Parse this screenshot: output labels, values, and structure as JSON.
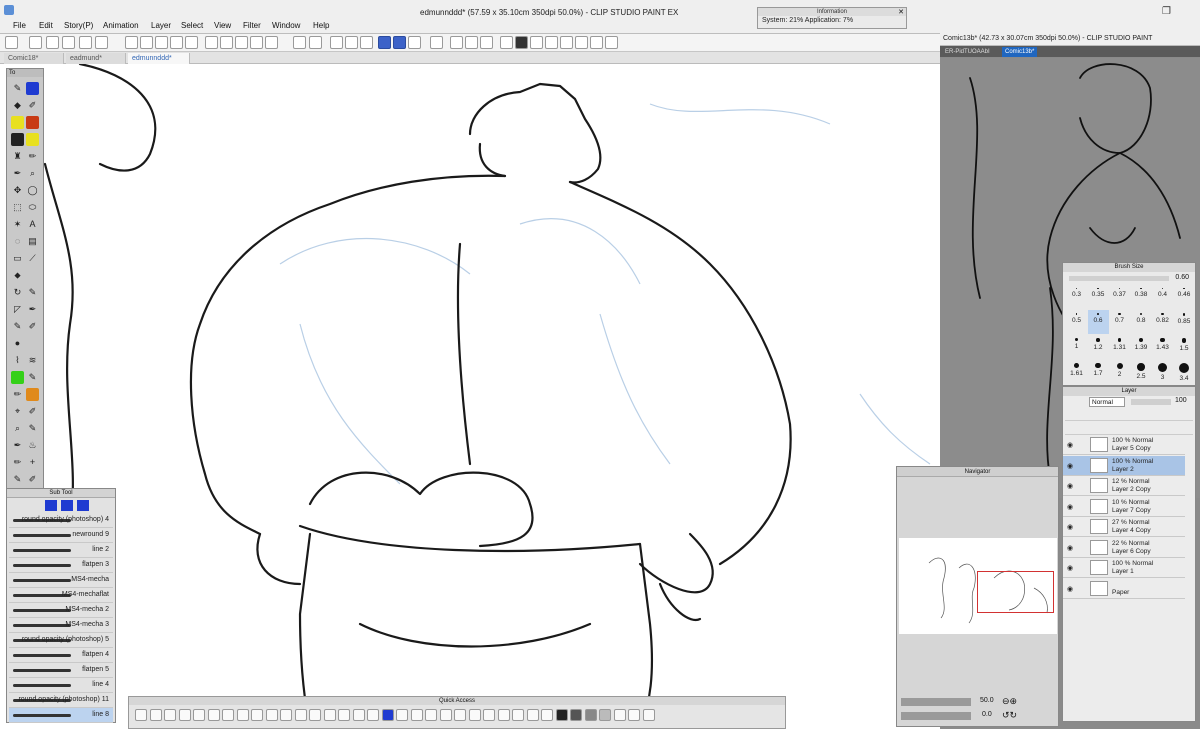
{
  "app": {
    "main_title": "edmunnddd* (57.59 x 35.10cm 350dpi 50.0%) - CLIP STUDIO PAINT EX",
    "menu": [
      "File",
      "Edit",
      "Story(P)",
      "Animation",
      "Layer",
      "Select",
      "View",
      "Filter",
      "Window",
      "Help"
    ]
  },
  "doc_tabs": [
    "Comic18*",
    "eadmund*",
    "edmunnddd*"
  ],
  "info_window": {
    "title": "Information",
    "system": "System: 21%  Application: 7%"
  },
  "right_doc": {
    "title": "Comic13b* (42.73 x 30.07cm 350dpi 50.0%) - CLIP STUDIO PAINT",
    "tabs": [
      "ER-PidTUOAAbI",
      "Comic13b*"
    ]
  },
  "tool_palette": {
    "title": "To"
  },
  "sub_tool": {
    "title": "Sub Tool",
    "items": [
      "round opacity (photoshop) 4",
      "newround 9",
      "line 2",
      "flatpen 3",
      "MS4-mecha",
      "MS4-mechaflat",
      "MS4-mecha 2",
      "MS4-mecha 3",
      "round opacity (photoshop) 5",
      "flatpen 4",
      "flatpen 5",
      "line 4",
      "round opacity (photoshop) 11",
      "line 8"
    ]
  },
  "quick_access": {
    "title": "Quick Access"
  },
  "navigator": {
    "title": "Navigator",
    "zoom": "50.0",
    "angle": "0.0"
  },
  "brush_size": {
    "title": "Brush Size",
    "current": "0.60",
    "sizes": [
      "0.3",
      "0.35",
      "0.37",
      "0.38",
      "0.4",
      "0.46",
      "0.5",
      "0.6",
      "0.7",
      "0.8",
      "0.82",
      "0.85",
      "1",
      "1.2",
      "1.31",
      "1.39",
      "1.43",
      "1.5",
      "1.61",
      "1.7",
      "2",
      "2.5",
      "3",
      "3.4"
    ]
  },
  "layer_panel": {
    "title": "Layer",
    "blend_mode": "Normal",
    "opacity": "100",
    "layers": [
      {
        "line1": "100 % Normal",
        "line2": "Layer 5 Copy"
      },
      {
        "line1": "100 % Normal",
        "line2": "Layer 2"
      },
      {
        "line1": "12 % Normal",
        "line2": "Layer 2 Copy"
      },
      {
        "line1": "10 % Normal",
        "line2": "Layer 7 Copy"
      },
      {
        "line1": "27 % Normal",
        "line2": "Layer 4 Copy"
      },
      {
        "line1": "22 % Normal",
        "line2": "Layer 6 Copy"
      },
      {
        "line1": "100 % Normal",
        "line2": "Layer 1"
      },
      {
        "line1": "",
        "line2": "Paper"
      }
    ]
  }
}
